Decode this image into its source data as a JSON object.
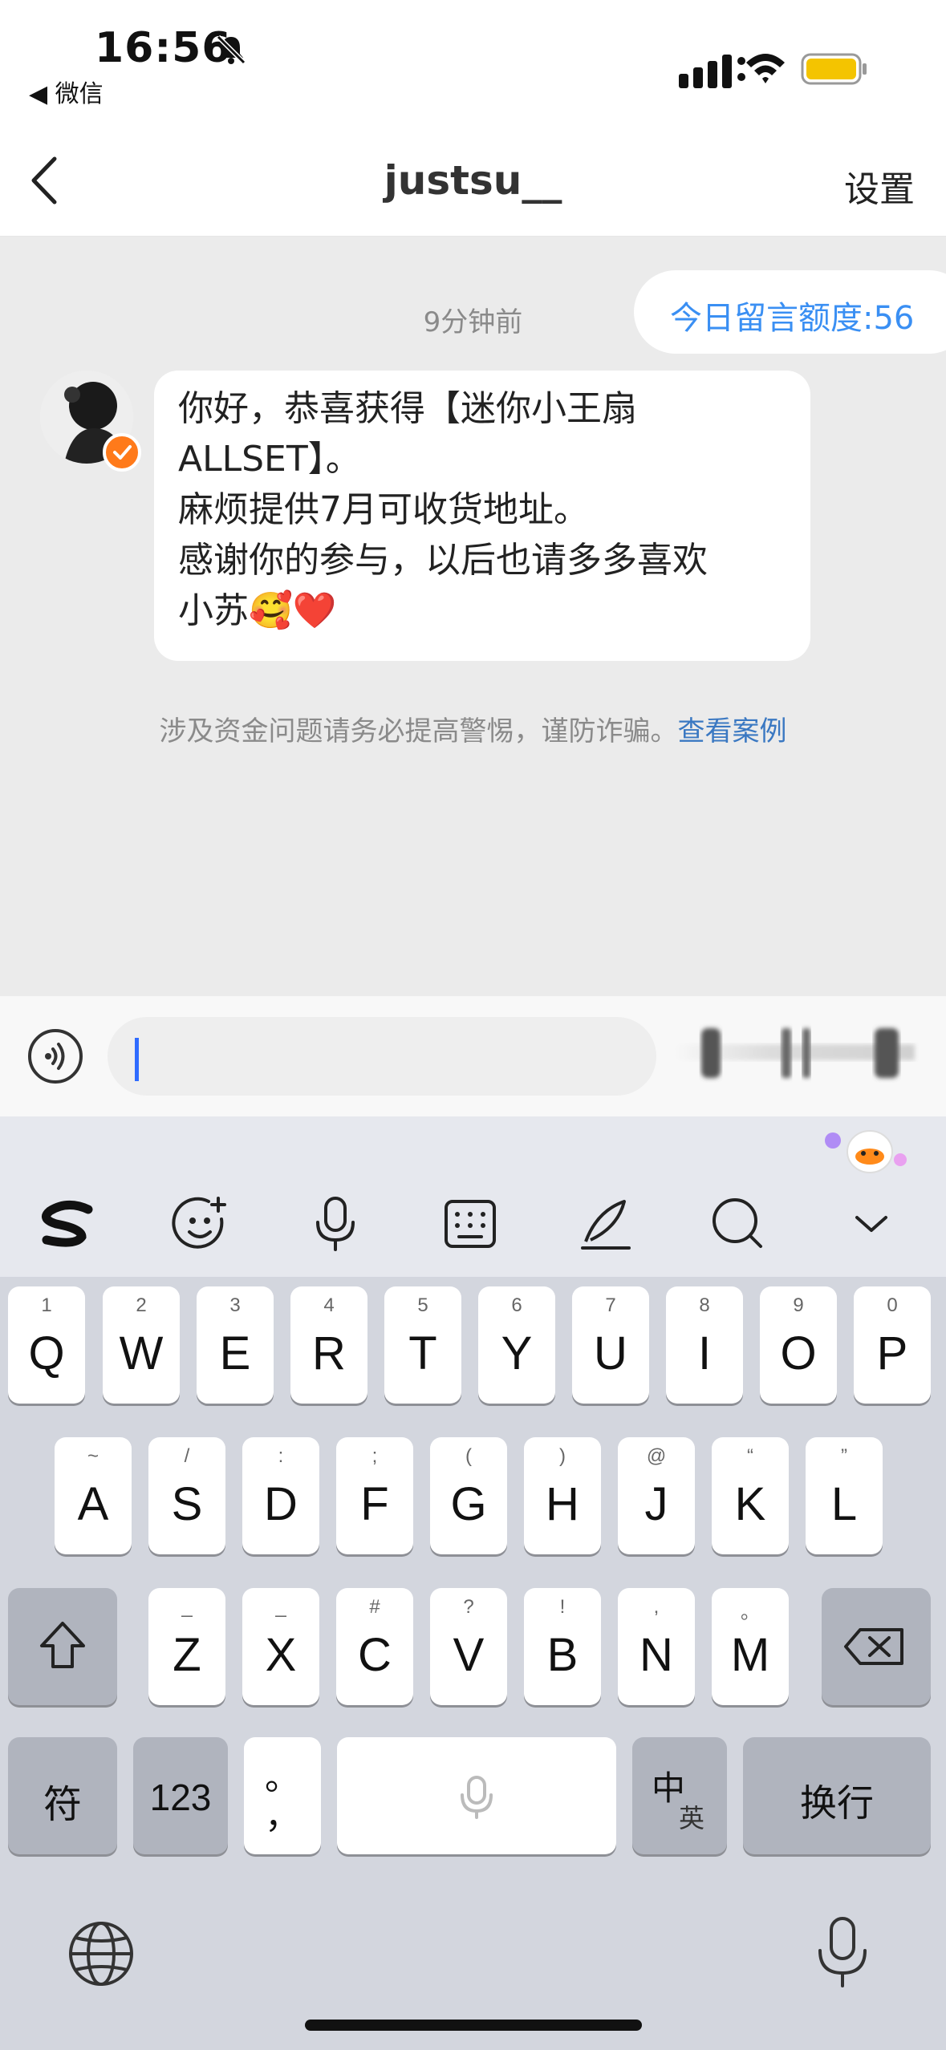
{
  "status_bar": {
    "time": "16:56",
    "back_app": "◀ 微信"
  },
  "nav": {
    "title": "justsu__",
    "settings": "设置"
  },
  "chat": {
    "quota": "今日留言额度:56",
    "timestamp": "9分钟前",
    "message_lines": [
      "你好，恭喜获得【迷你小王扇",
      "ALLSET】。",
      "麻烦提供7月可收货地址。",
      "感谢你的参与，以后也请多多喜欢",
      "小苏🥰❤️"
    ],
    "warning": "涉及资金问题请务必提高警惕，谨防诈骗。",
    "warning_link": "查看案例"
  },
  "input": {
    "placeholder": ""
  },
  "keyboard": {
    "row1": [
      {
        "letter": "Q",
        "sub": "1"
      },
      {
        "letter": "W",
        "sub": "2"
      },
      {
        "letter": "E",
        "sub": "3"
      },
      {
        "letter": "R",
        "sub": "4"
      },
      {
        "letter": "T",
        "sub": "5"
      },
      {
        "letter": "Y",
        "sub": "6"
      },
      {
        "letter": "U",
        "sub": "7"
      },
      {
        "letter": "I",
        "sub": "8"
      },
      {
        "letter": "O",
        "sub": "9"
      },
      {
        "letter": "P",
        "sub": "0"
      }
    ],
    "row2": [
      {
        "letter": "A",
        "sub": "~"
      },
      {
        "letter": "S",
        "sub": "/"
      },
      {
        "letter": "D",
        "sub": ":"
      },
      {
        "letter": "F",
        "sub": ";"
      },
      {
        "letter": "G",
        "sub": "("
      },
      {
        "letter": "H",
        "sub": ")"
      },
      {
        "letter": "J",
        "sub": "@"
      },
      {
        "letter": "K",
        "sub": "“"
      },
      {
        "letter": "L",
        "sub": "”"
      }
    ],
    "row3": [
      {
        "letter": "Z",
        "sub": "_"
      },
      {
        "letter": "X",
        "sub": "_"
      },
      {
        "letter": "C",
        "sub": "#"
      },
      {
        "letter": "V",
        "sub": "?"
      },
      {
        "letter": "B",
        "sub": "!"
      },
      {
        "letter": "N",
        "sub": ","
      },
      {
        "letter": "M",
        "sub": "。"
      }
    ],
    "symbols_label": "符",
    "numbers_label": "123",
    "punct_top": "。",
    "punct_bottom": "，",
    "lang_top": "中",
    "lang_bottom": "英",
    "return_label": "换行"
  }
}
